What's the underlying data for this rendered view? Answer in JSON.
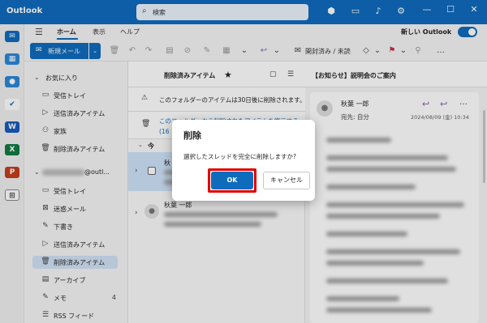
{
  "app": {
    "name": "Outlook"
  },
  "search": {
    "icon": "search-icon",
    "placeholder": "検索"
  },
  "ribbon_tabs": [
    {
      "label": "ホーム",
      "active": true
    },
    {
      "label": "表示"
    },
    {
      "label": "ヘルプ"
    }
  ],
  "new_outlook": {
    "label": "新しい Outlook",
    "on": true
  },
  "ribbon": {
    "new_mail": "新規メール",
    "mark_read": "開封済み / 未読"
  },
  "folders": {
    "favorites_title": "お気に入り",
    "favorites": [
      {
        "icon": "inbox-icon",
        "label": "受信トレイ"
      },
      {
        "icon": "send-icon",
        "label": "送信済みアイテム"
      },
      {
        "icon": "people-icon",
        "label": "家族"
      },
      {
        "icon": "trash-icon",
        "label": "削除済みアイテム"
      }
    ],
    "account_suffix": "@outl...",
    "account": [
      {
        "icon": "inbox-icon",
        "label": "受信トレイ"
      },
      {
        "icon": "junk-icon",
        "label": "迷惑メール"
      },
      {
        "icon": "draft-icon",
        "label": "下書き"
      },
      {
        "icon": "send-icon",
        "label": "送信済みアイテム"
      },
      {
        "icon": "trash-icon",
        "label": "削除済みアイテム",
        "selected": true
      },
      {
        "icon": "archive-icon",
        "label": "アーカイブ"
      },
      {
        "icon": "note-icon",
        "label": "メモ",
        "count": "4"
      },
      {
        "icon": "rss-icon",
        "label": "RSS フィード"
      }
    ]
  },
  "message_list": {
    "title": "削除済みアイテム",
    "notice1": "このフォルダーのアイテムは30日後に削除されます。",
    "notice2": "このフォルダーから削除されたアイテムを復元する (16 アイテム)",
    "group": "今",
    "rows": [
      {
        "sender": "秋",
        "selected": true
      },
      {
        "sender": "秋葉 一郎"
      }
    ]
  },
  "reading": {
    "subject": "【お知らせ】説明会のご案内",
    "sender": "秋葉 一郎",
    "to": "宛先: 自分",
    "date": "2024/08/09 (金) 10:34"
  },
  "dialog": {
    "title": "削除",
    "message": "選択したスレッドを完全に削除しますか?",
    "ok": "OK",
    "cancel": "キャンセル"
  },
  "colors": {
    "brand": "#0f6cbd",
    "highlight": "#e00000",
    "selected": "#d1e3f6"
  }
}
